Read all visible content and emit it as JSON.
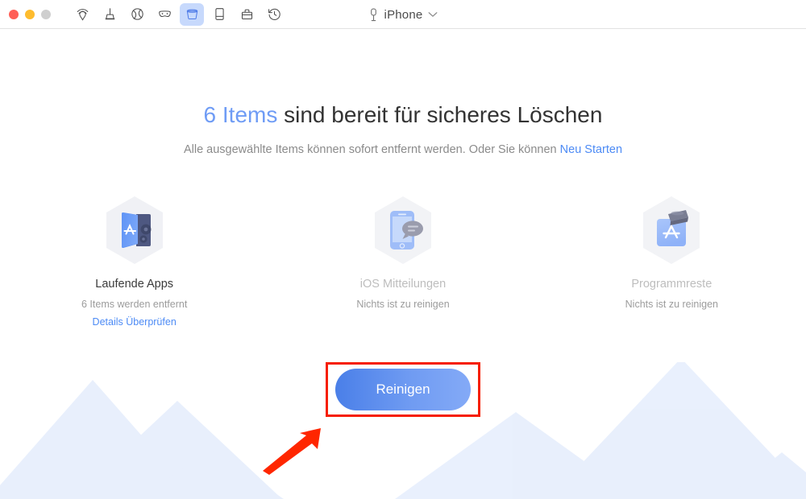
{
  "window": {
    "traffic_lights": [
      {
        "name": "close",
        "color": "#ff5f57"
      },
      {
        "name": "minimize",
        "color": "#febc2e"
      },
      {
        "name": "maximize",
        "color": "#cfcfcf"
      }
    ],
    "device_title": "iPhone"
  },
  "toolbar": {
    "items": [
      {
        "icon": "airdrop-icon",
        "label": "AirDrop",
        "active": false
      },
      {
        "icon": "plunger-icon",
        "label": "Clean",
        "active": false
      },
      {
        "icon": "globe-icon",
        "label": "Privacy",
        "active": false
      },
      {
        "icon": "mask-icon",
        "label": "Incognito",
        "active": false
      },
      {
        "icon": "bucket-icon",
        "label": "Junk Clean",
        "active": true
      },
      {
        "icon": "device-icon",
        "label": "Device",
        "active": false
      },
      {
        "icon": "toolbox-icon",
        "label": "Toolbox",
        "active": false
      },
      {
        "icon": "history-icon",
        "label": "History",
        "active": false
      }
    ]
  },
  "main": {
    "headline_accent": "6 Items",
    "headline_rest": " sind bereit für sicheres Löschen",
    "subtitle_text": "Alle ausgewählte Items können sofort entfernt werden. Oder Sie können ",
    "subtitle_link": "Neu Starten",
    "cards": [
      {
        "icon": "app-folder-gears-icon",
        "title": "Laufende Apps",
        "subtitle": "6 Items werden entfernt",
        "link": "Details Überprüfen",
        "muted": false
      },
      {
        "icon": "phone-message-icon",
        "title": "iOS  Mitteilungen",
        "subtitle": "Nichts ist zu reinigen",
        "link": "",
        "muted": true
      },
      {
        "icon": "app-box-icon",
        "title": "Programmreste",
        "subtitle": "Nichts ist zu reinigen",
        "link": "",
        "muted": true
      }
    ],
    "clean_button_label": "Reinigen"
  },
  "annotation": {
    "highlight_color": "#f61e00",
    "arrow_color": "#ff2600"
  },
  "colors": {
    "accent_blue": "#6f9cf5",
    "link_blue": "#4d8bf5",
    "text_dark": "#333333",
    "text_grey": "#8b8b8b",
    "mountain_light": "#e9f0fd",
    "mountain_mid": "#dce7fb"
  }
}
